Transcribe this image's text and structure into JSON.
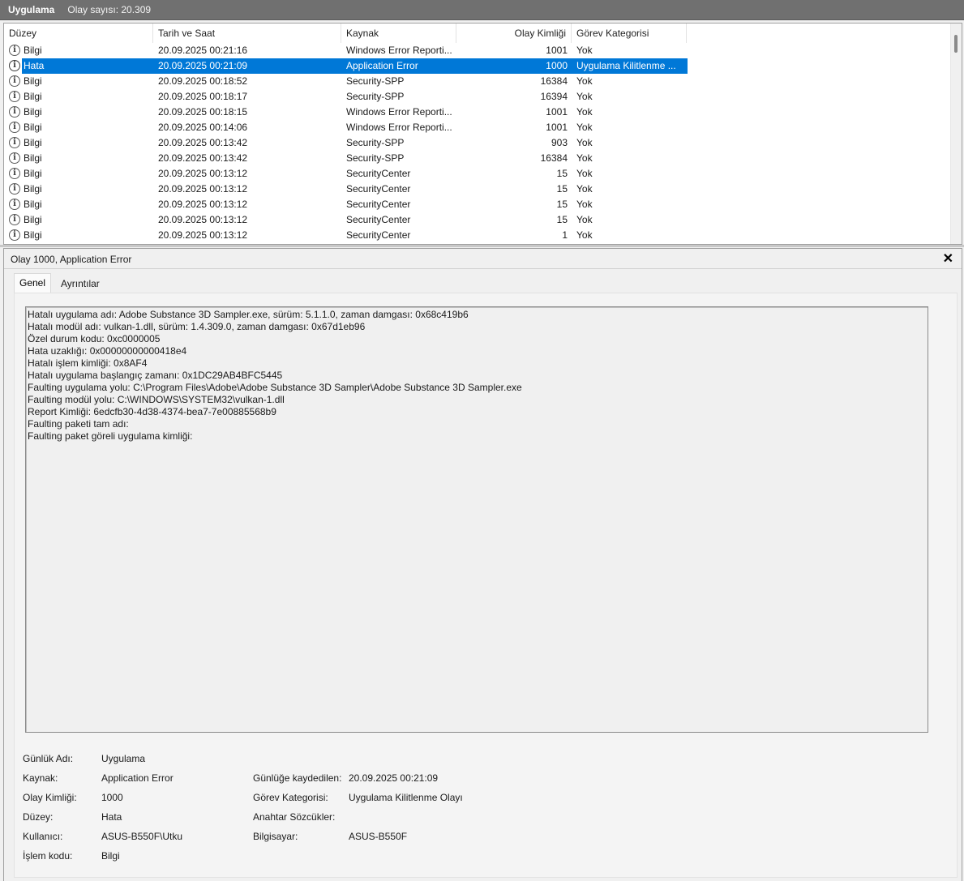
{
  "titlebar": {
    "app": "Uygulama",
    "count": "Olay sayısı: 20.309"
  },
  "columns": {
    "level": "Düzey",
    "datetime": "Tarih ve Saat",
    "source": "Kaynak",
    "event_id": "Olay Kimliği",
    "task": "Görev Kategorisi"
  },
  "rows": [
    {
      "level": "Bilgi",
      "datetime": "20.09.2025 00:21:16",
      "source": "Windows Error Reporti...",
      "event_id": "1001",
      "task": "Yok"
    },
    {
      "level": "Hata",
      "datetime": "20.09.2025 00:21:09",
      "source": "Application Error",
      "event_id": "1000",
      "task": "Uygulama Kilitlenme ..."
    },
    {
      "level": "Bilgi",
      "datetime": "20.09.2025 00:18:52",
      "source": "Security-SPP",
      "event_id": "16384",
      "task": "Yok"
    },
    {
      "level": "Bilgi",
      "datetime": "20.09.2025 00:18:17",
      "source": "Security-SPP",
      "event_id": "16394",
      "task": "Yok"
    },
    {
      "level": "Bilgi",
      "datetime": "20.09.2025 00:18:15",
      "source": "Windows Error Reporti...",
      "event_id": "1001",
      "task": "Yok"
    },
    {
      "level": "Bilgi",
      "datetime": "20.09.2025 00:14:06",
      "source": "Windows Error Reporti...",
      "event_id": "1001",
      "task": "Yok"
    },
    {
      "level": "Bilgi",
      "datetime": "20.09.2025 00:13:42",
      "source": "Security-SPP",
      "event_id": "903",
      "task": "Yok"
    },
    {
      "level": "Bilgi",
      "datetime": "20.09.2025 00:13:42",
      "source": "Security-SPP",
      "event_id": "16384",
      "task": "Yok"
    },
    {
      "level": "Bilgi",
      "datetime": "20.09.2025 00:13:12",
      "source": "SecurityCenter",
      "event_id": "15",
      "task": "Yok"
    },
    {
      "level": "Bilgi",
      "datetime": "20.09.2025 00:13:12",
      "source": "SecurityCenter",
      "event_id": "15",
      "task": "Yok"
    },
    {
      "level": "Bilgi",
      "datetime": "20.09.2025 00:13:12",
      "source": "SecurityCenter",
      "event_id": "15",
      "task": "Yok"
    },
    {
      "level": "Bilgi",
      "datetime": "20.09.2025 00:13:12",
      "source": "SecurityCenter",
      "event_id": "15",
      "task": "Yok"
    },
    {
      "level": "Bilgi",
      "datetime": "20.09.2025 00:13:12",
      "source": "SecurityCenter",
      "event_id": "1",
      "task": "Yok"
    }
  ],
  "selected_row": 1,
  "detail": {
    "title": "Olay 1000, Application Error",
    "close": "✕",
    "tabs": {
      "general": "Genel",
      "details": "Ayrıntılar"
    },
    "description": [
      "Hatalı uygulama adı: Adobe Substance 3D Sampler.exe, sürüm: 5.1.1.0, zaman damgası: 0x68c419b6",
      "Hatalı modül adı: vulkan-1.dll, sürüm: 1.4.309.0, zaman damgası: 0x67d1eb96",
      "Özel durum kodu: 0xc0000005",
      "Hata uzaklığı: 0x00000000000418e4",
      "Hatalı işlem kimliği: 0x8AF4",
      "Hatalı uygulama başlangıç zamanı: 0x1DC29AB4BFC5445",
      "Faulting uygulama yolu: C:\\Program Files\\Adobe\\Adobe Substance 3D Sampler\\Adobe Substance 3D Sampler.exe",
      "Faulting modül yolu: C:\\WINDOWS\\SYSTEM32\\vulkan-1.dll",
      "Report Kimliği: 6edcfb30-4d38-4374-bea7-7e00885568b9",
      "Faulting paketi tam adı:",
      "Faulting paket göreli uygulama kimliği:"
    ],
    "fields": {
      "log_name_label": "Günlük Adı:",
      "log_name": "Uygulama",
      "source_label": "Kaynak:",
      "source": "Application Error",
      "logged_label": "Günlüğe kaydedilen:",
      "logged": "20.09.2025 00:21:09",
      "event_id_label": "Olay Kimliği:",
      "event_id": "1000",
      "task_label": "Görev Kategorisi:",
      "task": "Uygulama Kilitlenme Olayı",
      "level_label": "Düzey:",
      "level": "Hata",
      "keywords_label": "Anahtar Sözcükler:",
      "keywords": "",
      "user_label": "Kullanıcı:",
      "user": "ASUS-B550F\\Utku",
      "computer_label": "Bilgisayar:",
      "computer": "ASUS-B550F",
      "opcode_label": "İşlem kodu:",
      "opcode": "Bilgi"
    }
  },
  "colors": {
    "selection": "#0078d7",
    "titlebar": "#707070"
  }
}
